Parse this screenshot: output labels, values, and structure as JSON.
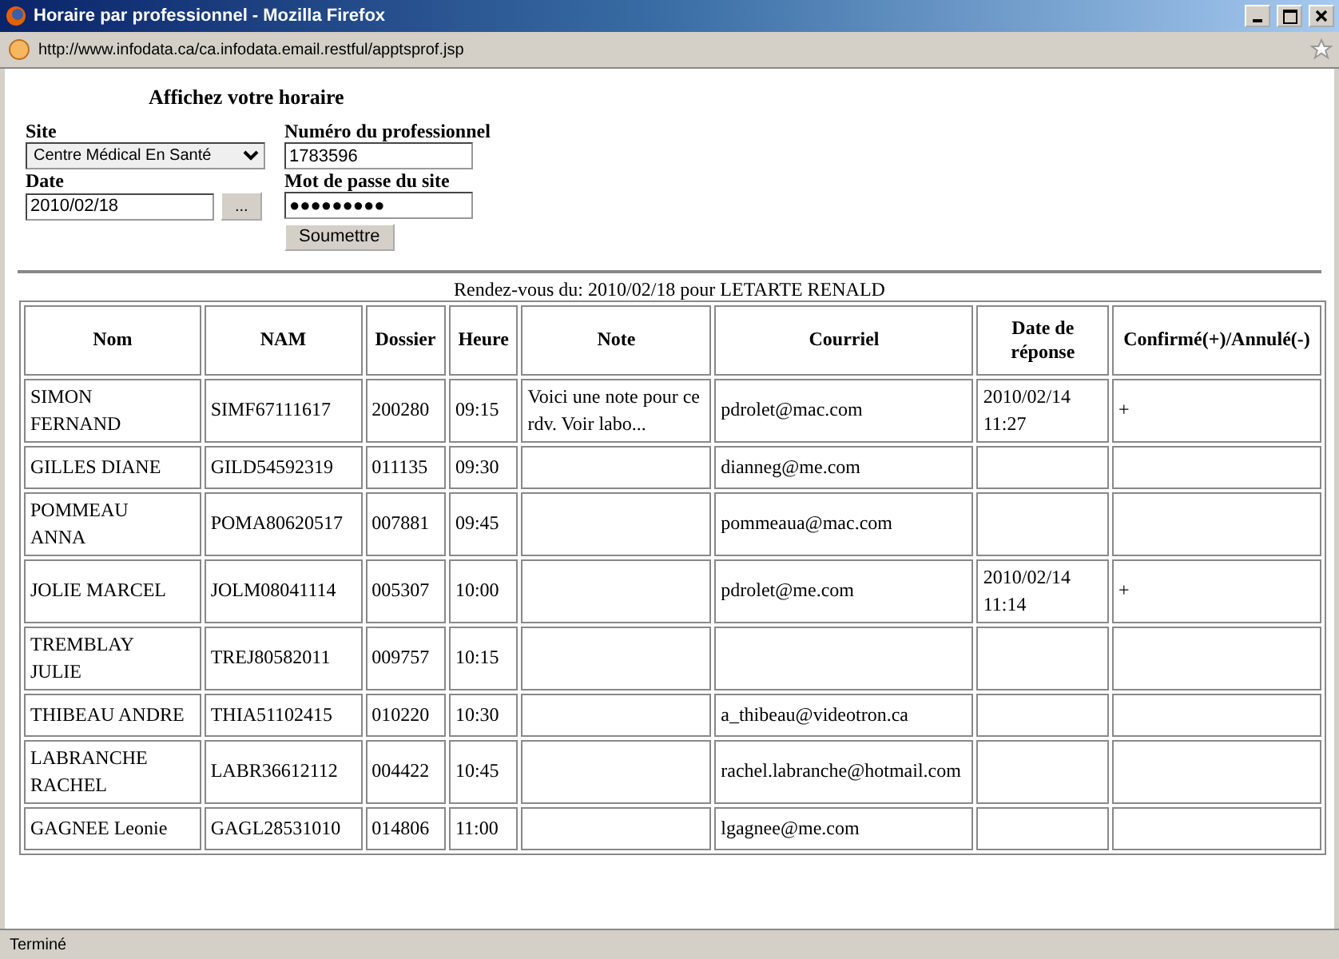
{
  "window": {
    "title": "Horaire par professionnel - Mozilla Firefox"
  },
  "address_bar": {
    "url": "http://www.infodata.ca/ca.infodata.email.restful/apptsprof.jsp"
  },
  "form": {
    "heading": "Affichez votre horaire",
    "site": {
      "label": "Site",
      "value": "Centre Médical En Santé"
    },
    "professional_number": {
      "label": "Numéro du professionnel",
      "value": "1783596"
    },
    "date": {
      "label": "Date",
      "value": "2010/02/18",
      "picker_button": "..."
    },
    "password": {
      "label": "Mot de passe du site",
      "value": "●●●●●●●●●"
    },
    "submit_button": "Soumettre"
  },
  "table": {
    "caption": "Rendez-vous du: 2010/02/18 pour LETARTE RENALD",
    "columns": [
      "Nom",
      "NAM",
      "Dossier",
      "Heure",
      "Note",
      "Courriel",
      "Date de réponse",
      "Confirmé(+)/Annulé(-)"
    ],
    "rows": [
      {
        "nom": "SIMON FERNAND",
        "nam": "SIMF67111617",
        "dossier": "200280",
        "heure": "09:15",
        "note": "Voici une note pour ce rdv. Voir labo...",
        "courriel": "pdrolet@mac.com",
        "date_reponse": "2010/02/14 11:27",
        "confirme": "+"
      },
      {
        "nom": "GILLES DIANE",
        "nam": "GILD54592319",
        "dossier": "011135",
        "heure": "09:30",
        "courriel": "dianneg@me.com"
      },
      {
        "nom": "POMMEAU ANNA",
        "nam": "POMA80620517",
        "dossier": "007881",
        "heure": "09:45",
        "courriel": "pommeaua@mac.com"
      },
      {
        "nom": "JOLIE MARCEL",
        "nam": "JOLM08041114",
        "dossier": "005307",
        "heure": "10:00",
        "courriel": "pdrolet@me.com",
        "date_reponse": "2010/02/14 11:14",
        "confirme": "+"
      },
      {
        "nom": "TREMBLAY JULIE",
        "nam": "TREJ80582011",
        "dossier": "009757",
        "heure": "10:15"
      },
      {
        "nom": "THIBEAU ANDRE",
        "nam": "THIA51102415",
        "dossier": "010220",
        "heure": "10:30",
        "courriel": "a_thibeau@videotron.ca"
      },
      {
        "nom": "LABRANCHE RACHEL",
        "nam": "LABR36612112",
        "dossier": "004422",
        "heure": "10:45",
        "courriel": "rachel.labranche@hotmail.com"
      },
      {
        "nom": "GAGNEE Leonie",
        "nam": "GAGL28531010",
        "dossier": "014806",
        "heure": "11:00",
        "courriel": "lgagnee@me.com"
      }
    ]
  },
  "status_bar": {
    "text": "Terminé"
  }
}
